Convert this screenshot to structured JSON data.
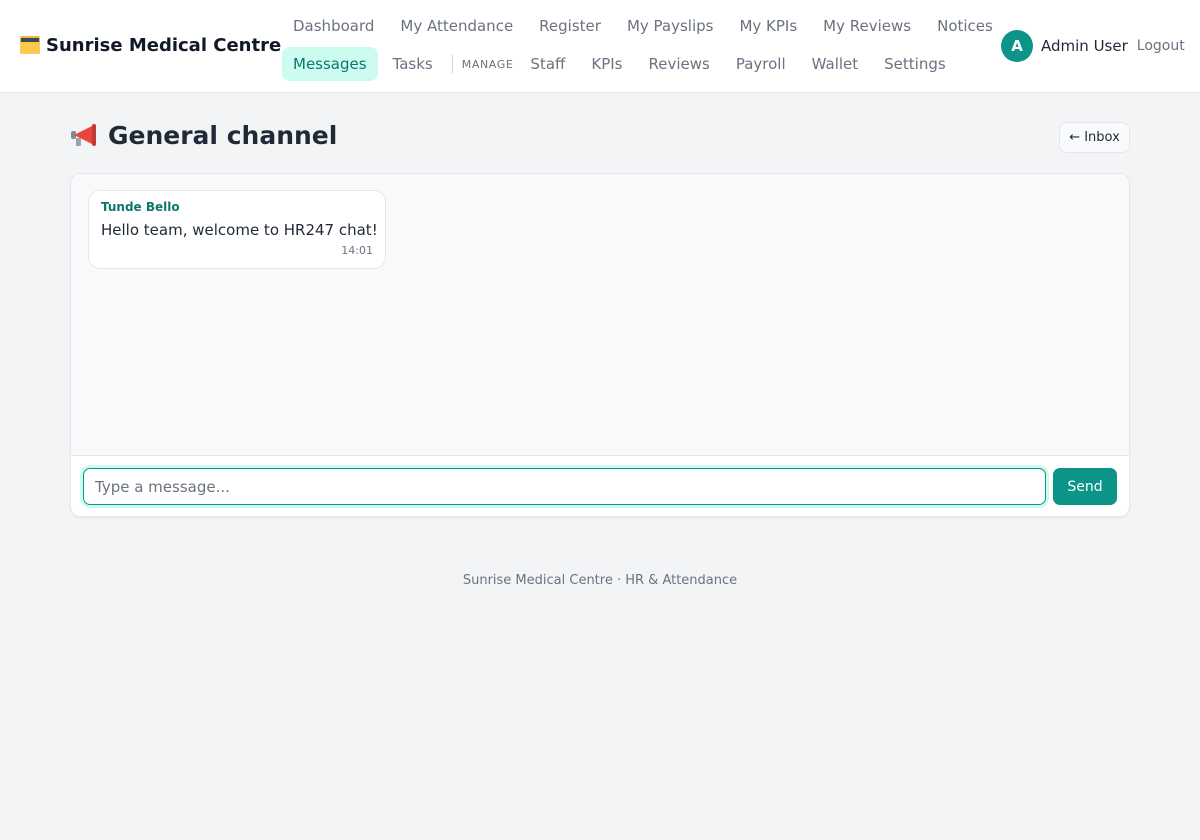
{
  "brand": {
    "name": "Sunrise Medical Centre",
    "icon": "card-index-dividers-icon"
  },
  "nav": {
    "row1": [
      "Dashboard",
      "My Attendance",
      "Register",
      "My Payslips",
      "My KPIs",
      "My Reviews",
      "Notices"
    ],
    "row2_personal": [
      "Messages",
      "Tasks"
    ],
    "manage_label": "MANAGE",
    "row2_manage": [
      "Staff",
      "KPIs",
      "Reviews",
      "Payroll",
      "Wallet",
      "Settings"
    ],
    "active": "Messages"
  },
  "user": {
    "initial": "A",
    "name": "Admin User",
    "logout_label": "Logout"
  },
  "page": {
    "icon": "megaphone-icon",
    "title": "General channel",
    "inbox_label": "← Inbox"
  },
  "messages": [
    {
      "sender": "Tunde Bello",
      "text": "Hello team, welcome to HR247 chat!",
      "time": "14:01"
    }
  ],
  "composer": {
    "placeholder": "Type a message...",
    "value": "",
    "send_label": "Send"
  },
  "footer": {
    "text": "Sunrise Medical Centre · HR & Attendance"
  },
  "colors": {
    "accent": "#0d9488",
    "accent_light": "#ccfbef",
    "accent_text": "#0f766e",
    "background": "#f3f4f6"
  }
}
